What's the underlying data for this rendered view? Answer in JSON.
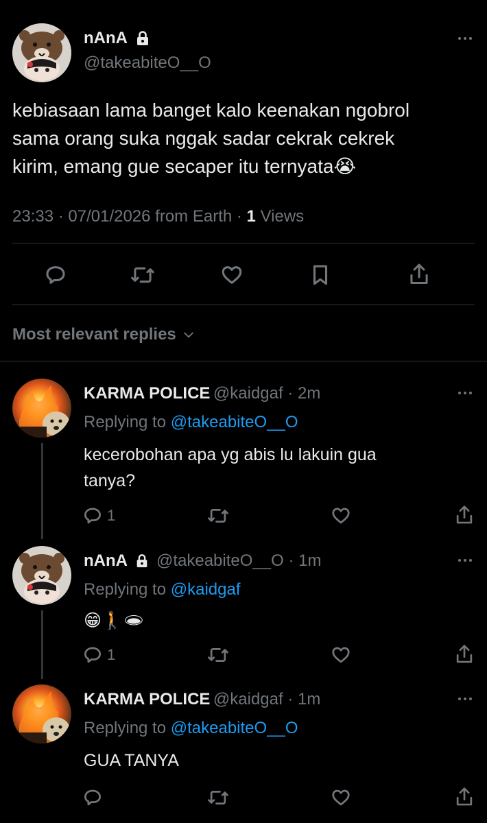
{
  "main_tweet": {
    "display_name": "nAnA",
    "handle": "@takeabiteO__O",
    "text_lines": [
      "kebiasaan lama banget kalo keenakan ngobrol",
      "sama orang suka nggak sadar cekrak cekrek",
      "kirim, emang gue secaper itu ternyata😭"
    ],
    "time": "23:33 · 07/01/2026 from Earth ·",
    "views_count": "1",
    "views_label": "Views"
  },
  "sort_label": "Most relevant replies",
  "replies": [
    {
      "display_name": "KARMA POLICE",
      "handle": "@kaidgaf · 2m",
      "replying_to_label": "Replying to",
      "replying_to_handle": "@takeabiteO__O",
      "text_lines": [
        "kecerobohan apa yg abis lu lakuin gua",
        "tanya?"
      ],
      "reply_count": "1"
    },
    {
      "display_name": "nAnA",
      "handle": "@takeabiteO__O · 1m",
      "replying_to_label": "Replying to",
      "replying_to_handle": "@kaidgaf",
      "text": "😁🚶🕳",
      "reply_count": "1"
    },
    {
      "display_name": "KARMA POLICE",
      "handle": "@kaidgaf · 1m",
      "replying_to_label": "Replying to",
      "replying_to_handle": "@takeabiteO__O",
      "text": "GUA TANYA",
      "reply_count": ""
    }
  ],
  "colors": {
    "background": "#000000",
    "text": "#e7e9ea",
    "muted": "#71767b",
    "link": "#1d9bf0",
    "divider": "#2f3336"
  }
}
